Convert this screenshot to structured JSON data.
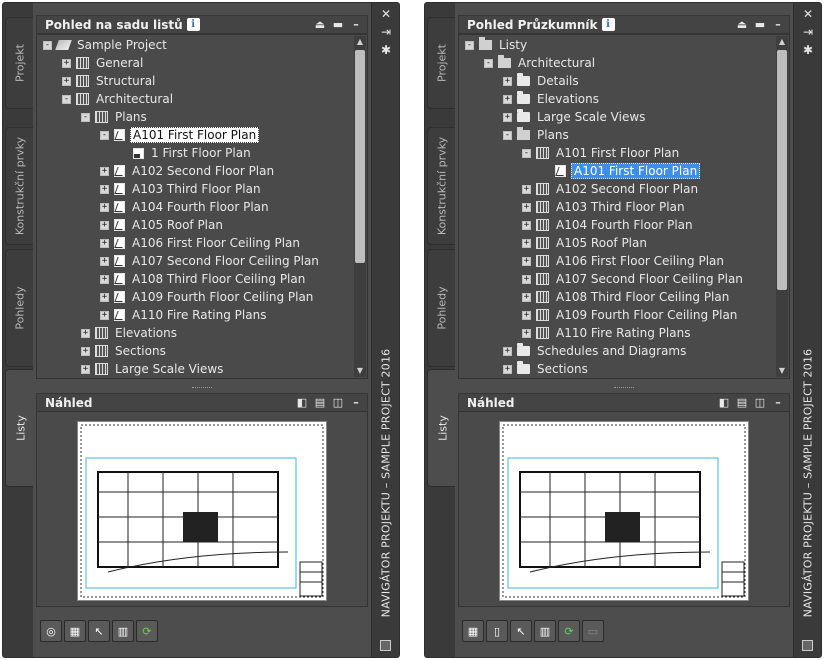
{
  "left": {
    "tabs": [
      "Projekt",
      "Konstrukční prvky",
      "Pohledy",
      "Listy"
    ],
    "tree_title": "Pohled na sadu listů",
    "info_glyph": "i",
    "preview_title": "Náhled",
    "side_title": "NAVIGÁTOR PROJEKTU – SAMPLE PROJECT 2016",
    "tree": [
      {
        "level": 0,
        "exp": "-",
        "icon": "proj",
        "label": "Sample Project"
      },
      {
        "level": 1,
        "exp": "+",
        "icon": "sheets",
        "label": "General"
      },
      {
        "level": 1,
        "exp": "+",
        "icon": "sheets",
        "label": "Structural"
      },
      {
        "level": 1,
        "exp": "-",
        "icon": "sheets",
        "label": "Architectural"
      },
      {
        "level": 2,
        "exp": "-",
        "icon": "sheets",
        "label": "Plans"
      },
      {
        "level": 3,
        "exp": "-",
        "icon": "sheet",
        "label": "A101 First Floor Plan",
        "sel": "white"
      },
      {
        "level": 4,
        "exp": "",
        "icon": "view",
        "label": "1 First Floor Plan"
      },
      {
        "level": 3,
        "exp": "+",
        "icon": "sheet",
        "label": "A102 Second Floor Plan"
      },
      {
        "level": 3,
        "exp": "+",
        "icon": "sheet",
        "label": "A103 Third Floor Plan"
      },
      {
        "level": 3,
        "exp": "+",
        "icon": "sheet",
        "label": "A104 Fourth Floor Plan"
      },
      {
        "level": 3,
        "exp": "+",
        "icon": "sheet",
        "label": "A105 Roof Plan"
      },
      {
        "level": 3,
        "exp": "+",
        "icon": "sheet",
        "label": "A106 First Floor Ceiling Plan"
      },
      {
        "level": 3,
        "exp": "+",
        "icon": "sheet",
        "label": "A107 Second Floor Ceiling Plan"
      },
      {
        "level": 3,
        "exp": "+",
        "icon": "sheet",
        "label": "A108 Third Floor Ceiling Plan"
      },
      {
        "level": 3,
        "exp": "+",
        "icon": "sheet",
        "label": "A109 Fourth Floor Ceiling Plan"
      },
      {
        "level": 3,
        "exp": "+",
        "icon": "sheet",
        "label": "A110 Fire Rating Plans"
      },
      {
        "level": 2,
        "exp": "+",
        "icon": "sheets",
        "label": "Elevations"
      },
      {
        "level": 2,
        "exp": "+",
        "icon": "sheets",
        "label": "Sections"
      },
      {
        "level": 2,
        "exp": "+",
        "icon": "sheets",
        "label": "Large Scale Views"
      }
    ]
  },
  "right": {
    "tabs": [
      "Projekt",
      "Konstrukční prvky",
      "Pohledy",
      "Listy"
    ],
    "tree_title": "Pohled Průzkumník",
    "info_glyph": "i",
    "preview_title": "Náhled",
    "side_title": "NAVIGÁTOR PROJEKTU – SAMPLE PROJECT 2016",
    "tree": [
      {
        "level": 0,
        "exp": "-",
        "icon": "folderopen",
        "label": "Listy"
      },
      {
        "level": 1,
        "exp": "-",
        "icon": "folderopen",
        "label": "Architectural"
      },
      {
        "level": 2,
        "exp": "+",
        "icon": "folder",
        "label": "Details"
      },
      {
        "level": 2,
        "exp": "+",
        "icon": "folder",
        "label": "Elevations"
      },
      {
        "level": 2,
        "exp": "+",
        "icon": "folder",
        "label": "Large Scale Views"
      },
      {
        "level": 2,
        "exp": "-",
        "icon": "folderopen",
        "label": "Plans"
      },
      {
        "level": 3,
        "exp": "-",
        "icon": "sheets",
        "label": "A101 First Floor Plan"
      },
      {
        "level": 4,
        "exp": "",
        "icon": "sheet",
        "label": "A101 First Floor Plan",
        "sel": "blue"
      },
      {
        "level": 3,
        "exp": "+",
        "icon": "sheets",
        "label": "A102 Second Floor Plan"
      },
      {
        "level": 3,
        "exp": "+",
        "icon": "sheets",
        "label": "A103 Third Floor Plan"
      },
      {
        "level": 3,
        "exp": "+",
        "icon": "sheets",
        "label": "A104 Fourth Floor Plan"
      },
      {
        "level": 3,
        "exp": "+",
        "icon": "sheets",
        "label": "A105 Roof Plan"
      },
      {
        "level": 3,
        "exp": "+",
        "icon": "sheets",
        "label": "A106 First Floor Ceiling Plan"
      },
      {
        "level": 3,
        "exp": "+",
        "icon": "sheets",
        "label": "A107 Second Floor Ceiling Plan"
      },
      {
        "level": 3,
        "exp": "+",
        "icon": "sheets",
        "label": "A108 Third Floor Ceiling Plan"
      },
      {
        "level": 3,
        "exp": "+",
        "icon": "sheets",
        "label": "A109 Fourth Floor Ceiling Plan"
      },
      {
        "level": 3,
        "exp": "+",
        "icon": "sheets",
        "label": "A110 Fire Rating Plans"
      },
      {
        "level": 2,
        "exp": "+",
        "icon": "folder",
        "label": "Schedules and Diagrams"
      },
      {
        "level": 2,
        "exp": "+",
        "icon": "folder",
        "label": "Sections"
      }
    ]
  },
  "side_buttons": {
    "close": "✕",
    "pin": "⇥",
    "settings": "✱"
  },
  "header_collapse": "–"
}
